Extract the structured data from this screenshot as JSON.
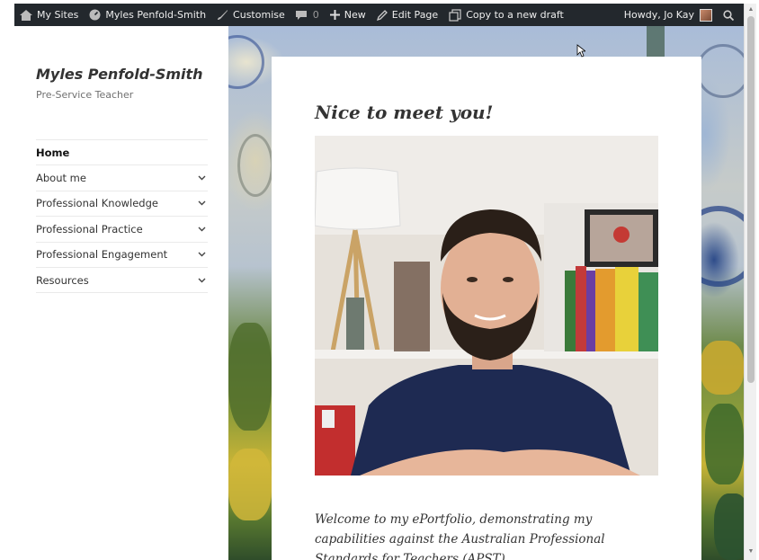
{
  "adminbar": {
    "my_sites": "My Sites",
    "site_name": "Myles Penfold-Smith",
    "customise": "Customise",
    "comments_count": "0",
    "new": "New",
    "edit_page": "Edit Page",
    "copy_draft": "Copy to a new draft",
    "howdy": "Howdy, Jo Kay"
  },
  "site": {
    "title": "Myles Penfold-Smith",
    "description": "Pre-Service Teacher"
  },
  "menu": [
    {
      "label": "Home",
      "active": true,
      "has_children": false
    },
    {
      "label": "About me",
      "has_children": true
    },
    {
      "label": "Professional Knowledge",
      "has_children": true
    },
    {
      "label": "Professional Practice",
      "has_children": true
    },
    {
      "label": "Professional Engagement",
      "has_children": true
    },
    {
      "label": "Resources",
      "has_children": true
    }
  ],
  "page": {
    "title": "Nice to meet you!",
    "intro": "Welcome to my ePortfolio, demonstrating my capabilities against the Australian Professional Standards for Teachers (APST)"
  },
  "colors": {
    "adminbar_bg": "#23282d",
    "text": "#333333",
    "border": "#eaeaea"
  }
}
